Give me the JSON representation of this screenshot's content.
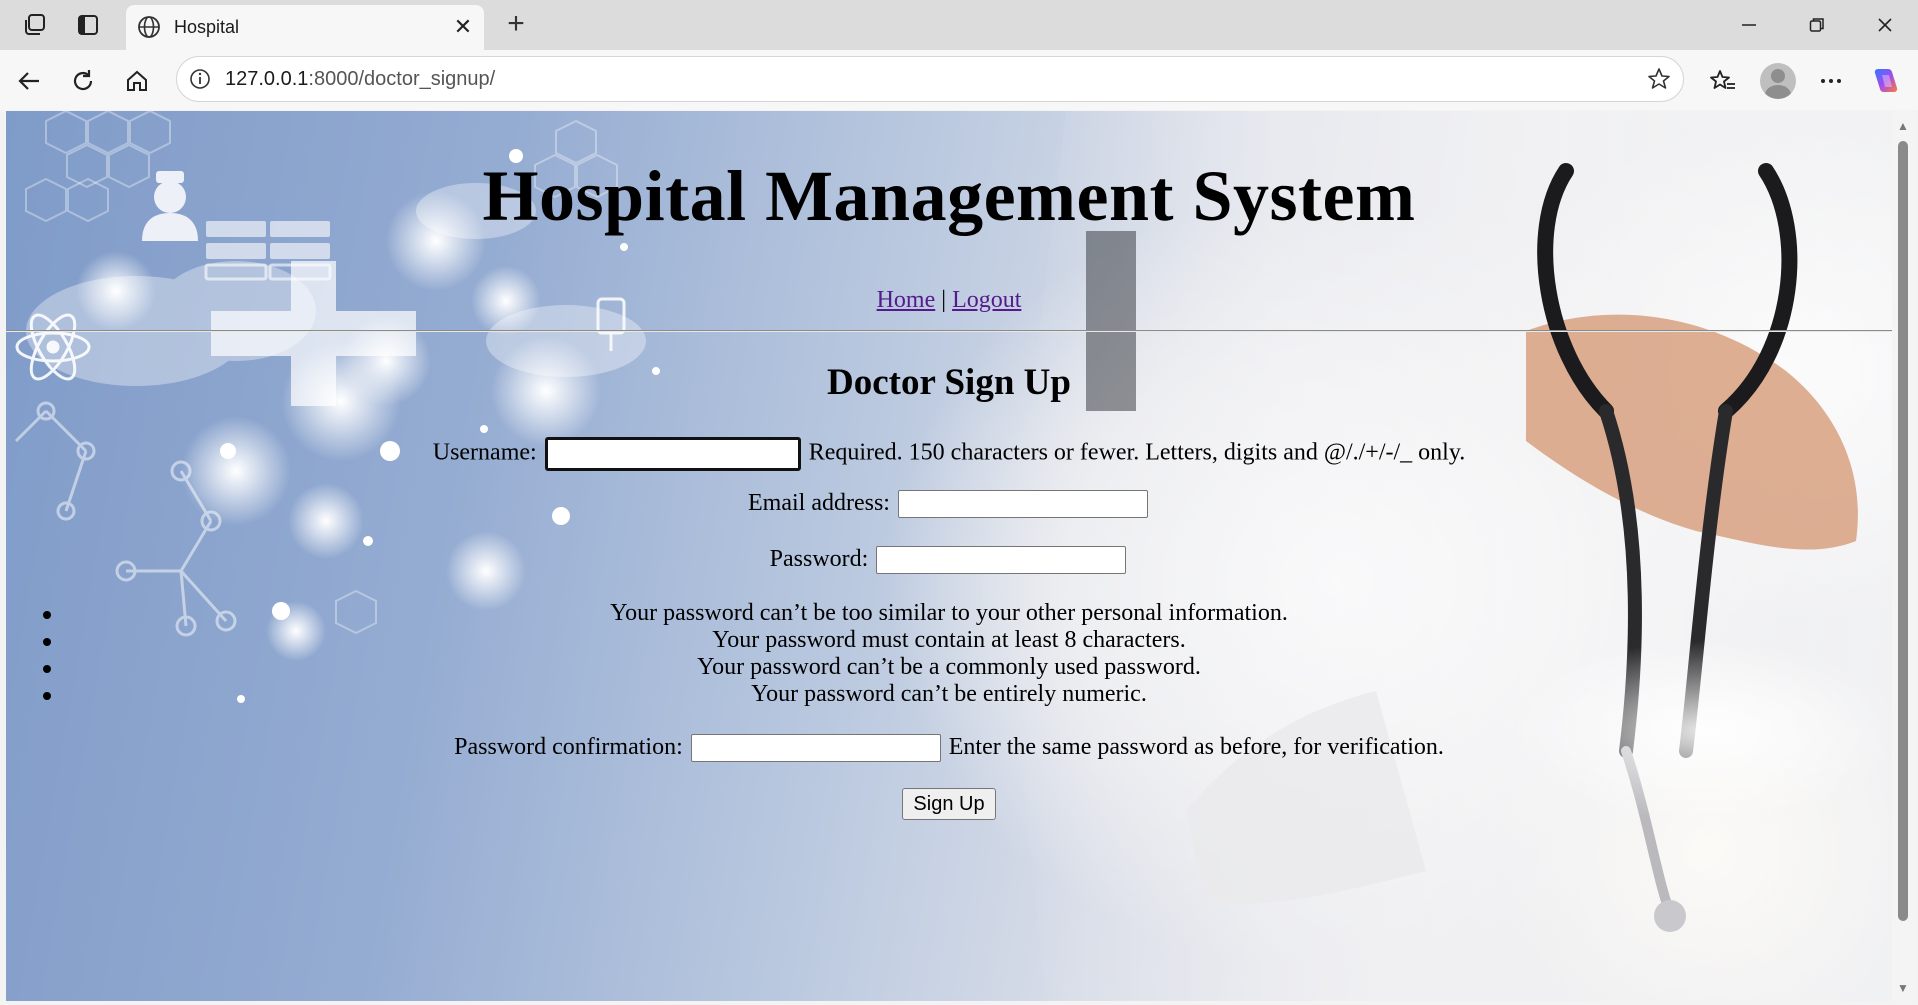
{
  "browser": {
    "tab_title": "Hospital",
    "address": {
      "host": "127.0.0.1",
      "path": ":8000/doctor_signup/"
    }
  },
  "page": {
    "site_title": "Hospital Management System",
    "nav": {
      "home": "Home",
      "separator": "|",
      "logout": "Logout"
    },
    "form_title": "Doctor Sign Up",
    "username": {
      "label": "Username:",
      "value": "",
      "help": "Required. 150 characters or fewer. Letters, digits and @/./+/-/_ only."
    },
    "email": {
      "label": "Email address:",
      "value": ""
    },
    "password": {
      "label": "Password:",
      "value": ""
    },
    "password_help": [
      "Your password can’t be too similar to your other personal information.",
      "Your password must contain at least 8 characters.",
      "Your password can’t be a commonly used password.",
      "Your password can’t be entirely numeric."
    ],
    "password_confirmation": {
      "label": "Password confirmation:",
      "value": "",
      "help": "Enter the same password as before, for verification."
    },
    "submit_label": "Sign Up"
  },
  "icons": {
    "workspaces": "workspaces-icon",
    "tab_actions": "tab-actions-icon",
    "globe": "globe-icon",
    "close": "close-icon",
    "new_tab": "plus-icon",
    "back": "back-arrow-icon",
    "refresh": "refresh-icon",
    "home": "home-icon",
    "info": "info-icon",
    "favorite": "star-icon",
    "favorites": "favorites-icon",
    "more": "more-icon",
    "copilot": "copilot-icon"
  },
  "colors": {
    "link": "#551a8b",
    "accent_gradient": [
      "#7f9bc8",
      "#e9e9ec"
    ]
  }
}
